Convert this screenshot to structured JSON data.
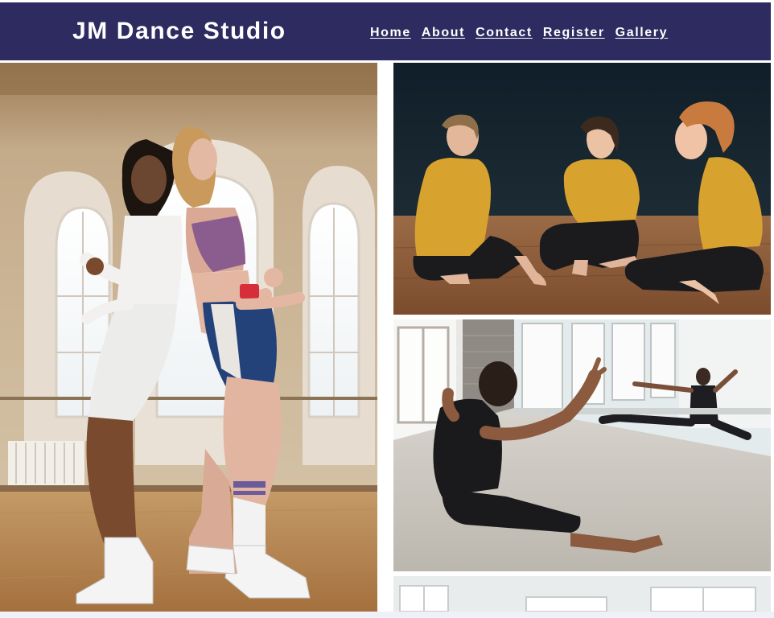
{
  "header": {
    "brand": "JM Dance Studio",
    "background": "#2d2b60",
    "text_color": "#ffffff"
  },
  "nav": {
    "links": [
      {
        "label": "Home"
      },
      {
        "label": "About"
      },
      {
        "label": "Contact"
      },
      {
        "label": "Register"
      },
      {
        "label": "Gallery"
      }
    ]
  },
  "gallery": {
    "photos": [
      {
        "subject": "two dancers in retro athletic wear dancing back to back in a sunlit studio"
      },
      {
        "subject": "three dancers in mustard tops sitting on a wooden studio floor"
      },
      {
        "subject": "male dancer stretching on the floor in front of a studio mirror"
      },
      {
        "subject": "bright studio with large windows"
      }
    ]
  }
}
